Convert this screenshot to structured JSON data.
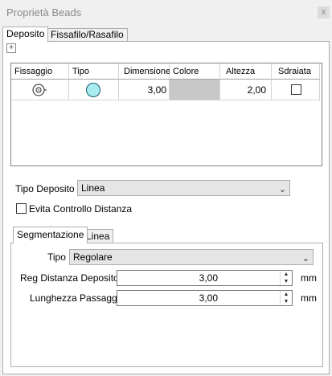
{
  "window": {
    "title": "Proprietà Beads",
    "close_glyph": "x"
  },
  "tabs": [
    {
      "label": "Deposito"
    },
    {
      "label": "Fissafilo/Rasafilo"
    }
  ],
  "add_glyph": "+",
  "grid": {
    "columns": [
      "Fissaggio",
      "Tipo",
      "Dimensione",
      "Colore",
      "Altezza",
      "Sdraiata"
    ],
    "rows": [
      {
        "fissaggio_icon": "target-icon",
        "tipo_icon": "circle-icon",
        "dimensione": "3,00",
        "colore": "#c8c8c8",
        "altezza": "2,00",
        "sdraiata": false
      }
    ]
  },
  "tipo_deposito": {
    "label": "Tipo Deposito",
    "value": "Linea"
  },
  "evita_controllo": {
    "label": "Evita Controllo Distanza",
    "checked": false
  },
  "subtabs": [
    {
      "label": "Segmentazione"
    },
    {
      "label": "Linea"
    }
  ],
  "segmentazione": {
    "tipo": {
      "label": "Tipo",
      "value": "Regolare"
    },
    "reg_distanza": {
      "label": "Reg Distanza Deposito",
      "value": "3,00",
      "unit": "mm"
    },
    "lunghezza": {
      "label": "Lunghezza Passaggi",
      "value": "3,00",
      "unit": "mm"
    }
  },
  "colors": {
    "circle_fill": "#a8ecf2",
    "circle_stroke": "#1a5a66",
    "combo_bg": "#e5e5e5"
  }
}
